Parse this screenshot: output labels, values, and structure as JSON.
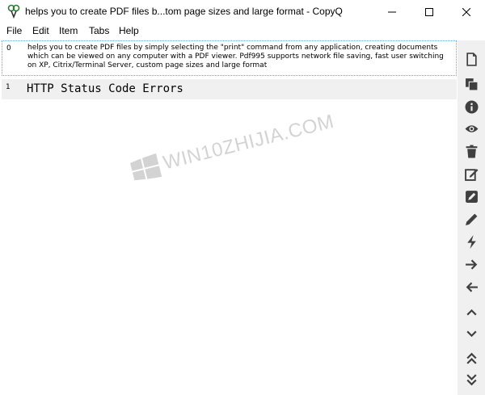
{
  "window": {
    "title": "helps you to create PDF files b...tom page sizes and large format - CopyQ"
  },
  "menu": [
    "File",
    "Edit",
    "Item",
    "Tabs",
    "Help"
  ],
  "items": [
    {
      "index": "0",
      "text": "helps you to create PDF files by simply selecting the \"print\" command from any application, creating documents which can be viewed on any computer with a PDF viewer. Pdf995 supports network file saving, fast user switching on XP, Citrix/Terminal Server, custom page sizes and large format"
    },
    {
      "index": "1",
      "text": "HTTP Status Code Errors"
    }
  ],
  "toolbar_icons": [
    "new-item-icon",
    "copy-icon",
    "info-icon",
    "eye-icon",
    "trash-icon",
    "edit-icon",
    "edit-alt-icon",
    "pencil-icon",
    "bolt-icon",
    "arrow-right-icon",
    "arrow-left-icon",
    "chevron-up-icon",
    "chevron-down-icon",
    "double-chevron-up-icon",
    "double-chevron-down-icon"
  ],
  "watermark": {
    "text": "WIN10ZHIJIA.COM"
  },
  "colors": {
    "icon": "#404040",
    "selection_border": "#6fa7d8",
    "toolbar_bg": "#f0f0f0"
  }
}
